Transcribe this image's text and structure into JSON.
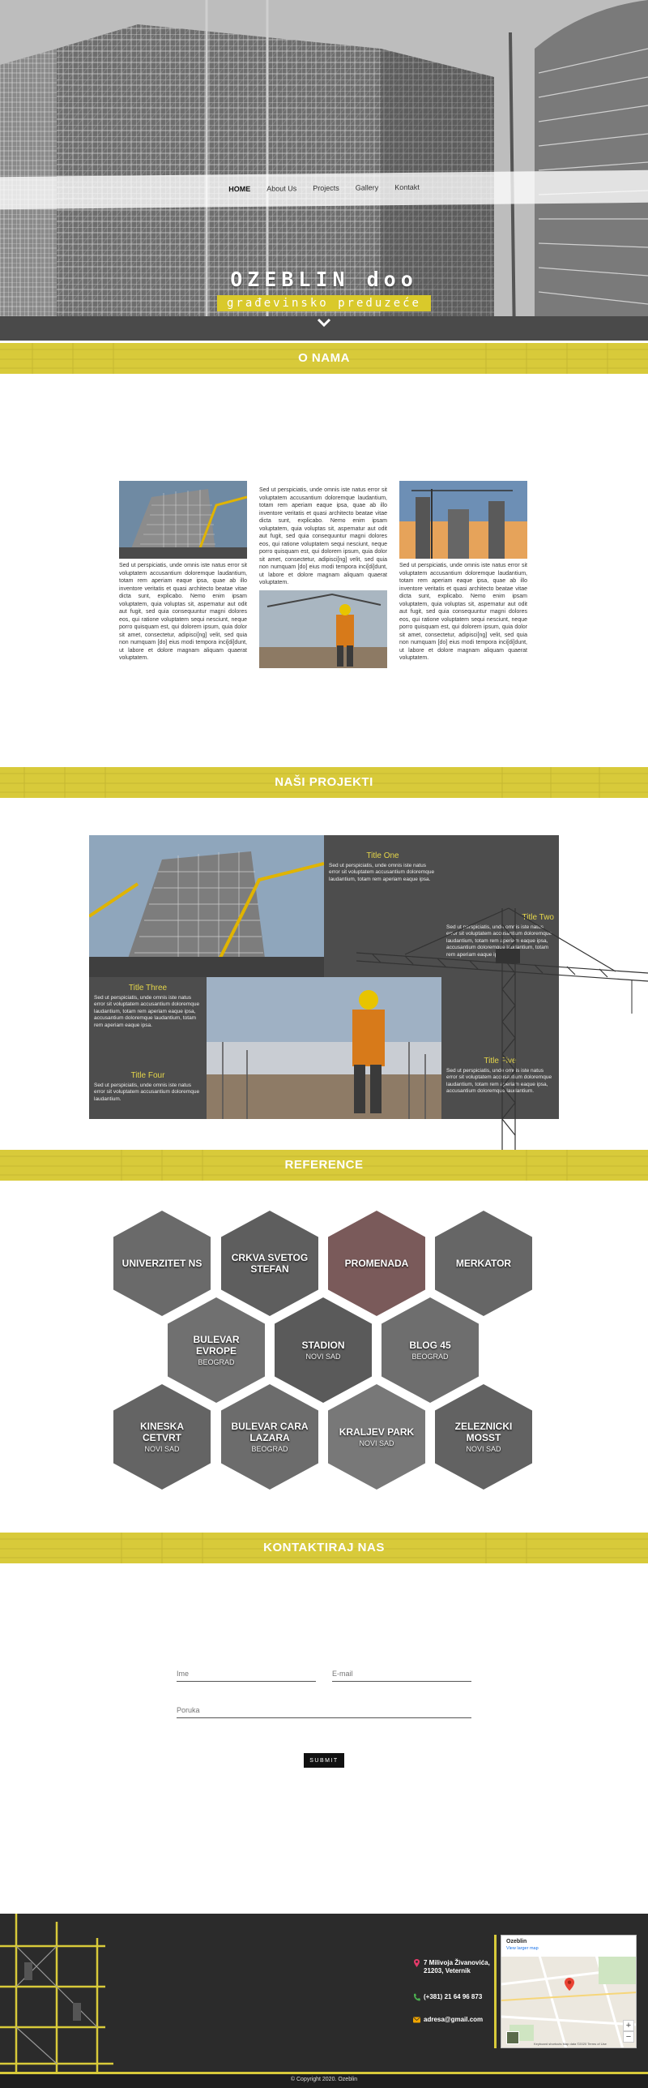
{
  "nav": {
    "items": [
      "HOME",
      "About Us",
      "Projects",
      "Gallery",
      "Kontakt"
    ],
    "active_index": 0
  },
  "hero": {
    "title": "OZEBLIN doo",
    "subtitle": "građevinsko preduzeće",
    "scroll_icon": "chevron-down-icon"
  },
  "sections": {
    "about": "O NAMA",
    "projects": "NAŠI PROJEKTI",
    "references": "REFERENCE",
    "contact": "KONTAKTIRAJ NAS"
  },
  "about": {
    "col1_text": "Sed ut perspiciatis, unde omnis iste natus error sit voluptatem accusantium doloremque laudantium, totam rem aperiam eaque ipsa, quae ab illo inventore veritatis et quasi architecto beatae vitae dicta sunt, explicabo. Nemo enim ipsam voluptatem, quia voluptas sit, aspernatur aut odit aut fugit, sed quia consequuntur magni dolores eos, qui ratione voluptatem sequi nesciunt, neque porro quisquam est, qui dolorem ipsum, quia dolor sit amet, consectetur, adipisci[ng] velit, sed quia non numquam [do] eius modi tempora inci[di]dunt, ut labore et dolore magnam aliquam quaerat voluptatem.",
    "col2_text": "Sed ut perspiciatis, unde omnis iste natus error sit voluptatem accusantium doloremque laudantium, totam rem aperiam eaque ipsa, quae ab illo inventore veritatis et quasi architecto beatae vitae dicta sunt, explicabo. Nemo enim ipsam voluptatem, quia voluptas sit, aspernatur aut odit aut fugit, sed quia consequuntur magni dolores eos, qui ratione voluptatem sequi nesciunt, neque porro quisquam est, qui dolorem ipsum, quia dolor sit amet, consectetur, adipisci[ng] velit, sed quia non numquam [do] eius modi tempora inci[di]dunt, ut labore et dolore magnam aliquam quaerat voluptatem.",
    "col3_text": "Sed ut perspiciatis, unde omnis iste natus error sit voluptatem accusantium doloremque laudantium, totam rem aperiam eaque ipsa, quae ab illo inventore veritatis et quasi architecto beatae vitae dicta sunt, explicabo. Nemo enim ipsam voluptatem, quia voluptas sit, aspernatur aut odit aut fugit, sed quia consequuntur magni dolores eos, qui ratione voluptatem sequi nesciunt, neque porro quisquam est, qui dolorem ipsum, quia dolor sit amet, consectetur, adipisci[ng] velit, sed quia non numquam [do] eius modi tempora inci[di]dunt, ut labore et dolore magnam aliquam quaerat voluptatem."
  },
  "projects": [
    {
      "title": "Title One",
      "text": "Sed ut perspiciatis, unde omnis iste natus error sit voluptatem accusantium doloremque laudantium, totam rem aperiam eaque ipsa."
    },
    {
      "title": "Title Two",
      "text": "Sed ut perspiciatis, unde omnis iste natus error sit voluptatem accusantium doloremque laudantium, totam rem aperiam eaque ipsa, accusantium doloremque laudantium, totam rem aperiam eaque ipsa."
    },
    {
      "title": "Title Three",
      "text": "Sed ut perspiciatis, unde omnis iste natus error sit voluptatem accusantium doloremque laudantium, totam rem aperiam eaque ipsa, accusantium doloremque laudantium, totam rem aperiam eaque ipsa."
    },
    {
      "title": "Title Four",
      "text": "Sed ut perspiciatis, unde omnis iste natus error sit voluptatem accusantium doloremque laudantium."
    },
    {
      "title": "Title Five",
      "text": "Sed ut perspiciatis, unde omnis iste natus error sit voluptatem accusantium doloremque laudantium, totam rem aperiam eaque ipsa, accusantium doloremque laudantium."
    }
  ],
  "references": [
    {
      "title": "UNIVERZITET NS",
      "city": ""
    },
    {
      "title": "CRKVA SVETOG STEFAN",
      "city": ""
    },
    {
      "title": "PROMENADA",
      "city": ""
    },
    {
      "title": "MERKATOR",
      "city": ""
    },
    {
      "title": "BULEVAR EVROPE",
      "city": "BEOGRAD"
    },
    {
      "title": "STADION",
      "city": "NOVI SAD"
    },
    {
      "title": "BLOG 45",
      "city": "BEOGRAD"
    },
    {
      "title": "KINESKA CETVRT",
      "city": "NOVI SAD"
    },
    {
      "title": "BULEVAR CARA LAZARA",
      "city": "BEOGRAD"
    },
    {
      "title": "KRALJEV PARK",
      "city": "NOVI SAD"
    },
    {
      "title": "ZELEZNICKI MOSST",
      "city": "NOVI SAD"
    }
  ],
  "contact": {
    "name_placeholder": "Ime",
    "email_placeholder": "E-mail",
    "message_placeholder": "Poruka",
    "submit_label": "SUBMIT"
  },
  "footer": {
    "address_line1": "7 Milivoja Živanovića,",
    "address_line2": "21203, Veternik",
    "phone": "(+381) 21 64 96 873",
    "email": "adresa@gmail.com",
    "map_title": "Ozeblin",
    "map_link": "View larger map",
    "map_attribution": "Keyboard shortcuts   Map data ©2020   Terms of Use",
    "copyright": "© Copyright 2020. Ozeblin"
  },
  "colors": {
    "accent": "#d8ca3a",
    "footer_bg": "#2b2b2b",
    "project_cell": "#4d4d4d",
    "title_yellow": "#e5d64a"
  }
}
